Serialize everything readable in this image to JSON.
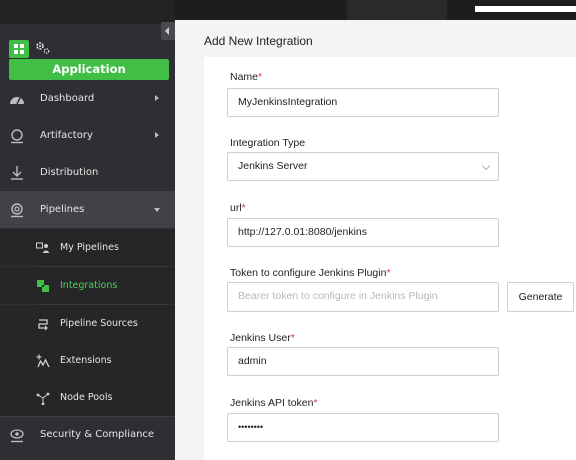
{
  "sidebar": {
    "app_label": "Application",
    "items": [
      {
        "label": "Dashboard",
        "icon": "gauge-icon"
      },
      {
        "label": "Artifactory",
        "icon": "artifactory-icon"
      },
      {
        "label": "Distribution",
        "icon": "distribution-icon"
      },
      {
        "label": "Pipelines",
        "icon": "pipelines-icon"
      }
    ],
    "sub_items": [
      {
        "label": "My Pipelines",
        "icon": "my-pipelines-icon"
      },
      {
        "label": "Integrations",
        "icon": "integrations-icon"
      },
      {
        "label": "Pipeline Sources",
        "icon": "pipeline-sources-icon"
      },
      {
        "label": "Extensions",
        "icon": "extensions-icon"
      },
      {
        "label": "Node Pools",
        "icon": "node-pools-icon"
      }
    ],
    "bottom_item": {
      "label": "Security & Compliance",
      "icon": "security-icon"
    }
  },
  "page": {
    "title": "Add New Integration"
  },
  "form": {
    "name": {
      "label": "Name",
      "value": "MyJenkinsIntegration"
    },
    "integration_type": {
      "label": "Integration Type",
      "value": "Jenkins Server"
    },
    "url": {
      "label": "url",
      "value": "http://127.0.01:8080/jenkins"
    },
    "token": {
      "label": "Token to configure Jenkins Plugin",
      "placeholder": "Bearer token to configure in Jenkins Plugin",
      "generate_label": "Generate"
    },
    "jenkins_user": {
      "label": "Jenkins User",
      "value": "admin"
    },
    "api_token": {
      "label": "Jenkins API token",
      "value": "••••••••"
    },
    "required_mark": "*"
  },
  "colors": {
    "accent": "#40be46",
    "required": "#e0363c",
    "sidebar_bg": "#2f2f33"
  }
}
